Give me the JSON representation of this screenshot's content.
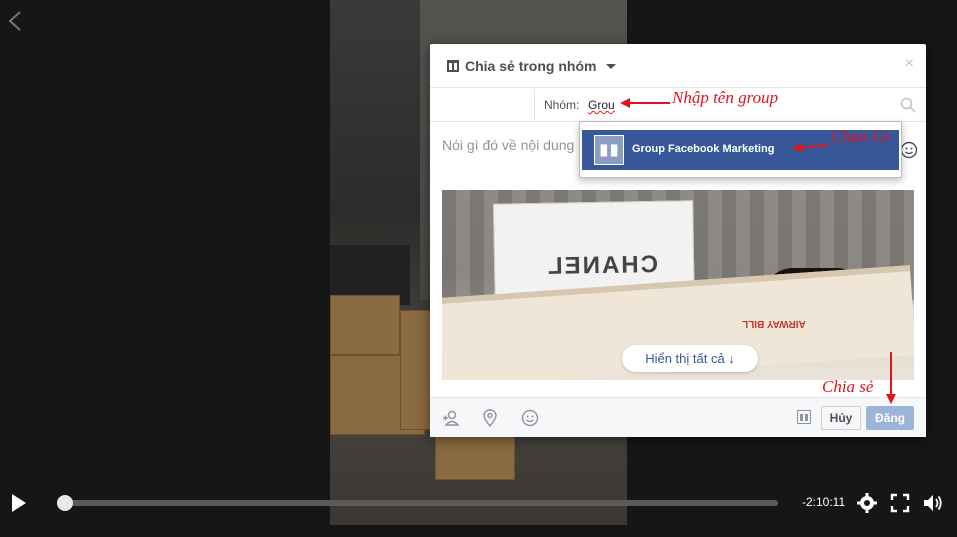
{
  "dialog": {
    "title": "Chia sẻ trong nhóm",
    "group_label": "Nhóm:",
    "group_value": "Grou",
    "compose_placeholder": "Nói gì đó về nội dung",
    "dropdown_item": "Group Facebook Marketing",
    "preview_card_text": "CHANEL",
    "preview_bill_text": "AIRWAY BILL",
    "show_all": "Hiển thị tất cả ↓",
    "cancel_label": "Hủy",
    "post_label": "Đăng",
    "close_glyph": "×"
  },
  "player": {
    "time_remaining": "-2:10:11",
    "progress_fraction": 0.0
  },
  "annotations": {
    "enter_group": "Nhập tên group",
    "choose_group": "Chọn Gr",
    "share": "Chia sẻ"
  },
  "colors": {
    "accent": "#365899",
    "annotation": "#e0141e",
    "post_button": "#9cb4d8"
  }
}
